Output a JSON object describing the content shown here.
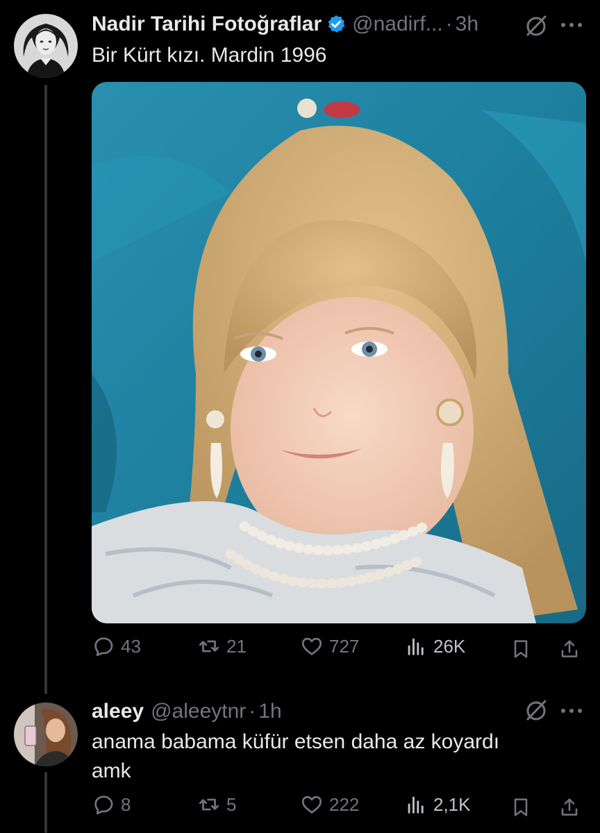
{
  "tweet": {
    "author_name": "Nadir Tarihi Fotoğraflar",
    "author_handle": "@nadirf...",
    "separator": "·",
    "time": "3h",
    "text": "Bir Kürt kızı. Mardin 1996",
    "stats": {
      "replies": "43",
      "retweets": "21",
      "likes": "727",
      "views": "26K"
    }
  },
  "reply": {
    "author_name": "aleey",
    "author_handle": "@aleeytnr",
    "separator": "·",
    "time": "1h",
    "text": "anama babama küfür etsen daha az koyardı amk",
    "stats": {
      "replies": "8",
      "retweets": "5",
      "likes": "222",
      "views": "2,1K"
    }
  },
  "colors": {
    "background": "#000000",
    "text_primary": "#e7e9ea",
    "text_secondary": "#71767b",
    "verified": "#1d9bf0",
    "thread_line": "#333639",
    "photo_backdrop": "#1e7f9e"
  },
  "icons": [
    "verified-badge-icon",
    "grok-icon",
    "more-icon",
    "reply-icon",
    "retweet-icon",
    "like-icon",
    "views-icon",
    "bookmark-icon",
    "share-icon"
  ]
}
